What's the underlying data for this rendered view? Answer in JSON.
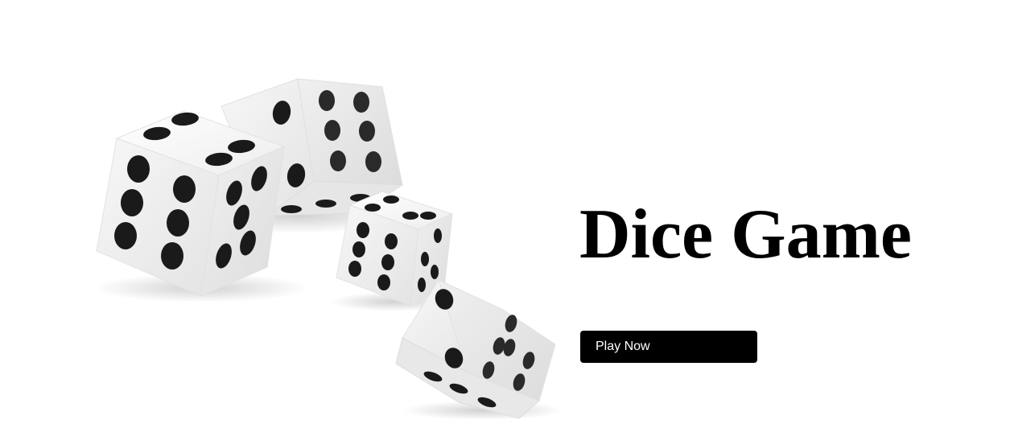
{
  "hero": {
    "title": "Dice Game",
    "button_label": "Play Now"
  },
  "illustration": {
    "icon": "dice-icon",
    "dice_count": 4
  },
  "colors": {
    "background": "#ffffff",
    "text": "#000000",
    "button_bg": "#000000",
    "button_text": "#ffffff",
    "pip": "#1a1a1a",
    "die_face": "#f2f2f2"
  }
}
